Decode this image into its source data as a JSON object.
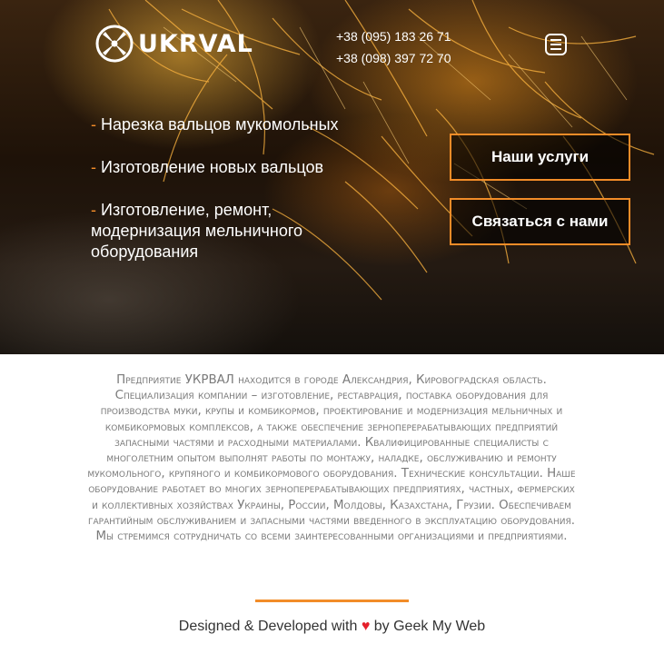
{
  "header": {
    "logo_text": "UKRVAL",
    "logo_icon": "ukrval-logo-mark-icon",
    "phones": [
      "+38 (095) 183 26 71",
      "+38 (098) 397 72 70"
    ],
    "menu_icon": "hamburger-menu-icon"
  },
  "hero": {
    "services": [
      {
        "bullet": "-",
        "text": "Нарезка вальцов мукомольных"
      },
      {
        "bullet": "-",
        "text": "Изготовление новых вальцов"
      },
      {
        "bullet": "-",
        "text": "Изготовление, ремонт, модернизация мельничного оборудования"
      }
    ],
    "buttons": {
      "services_label": "Наши услуги",
      "contact_label": "Связаться с нами"
    }
  },
  "about": {
    "text": "Предприятие УКРВАЛ находится в городе Александрия, Кировоградская область. Специализация компании – изготовление, реставрация, поставка оборудования для производства муки, крупы и комбикормов, проектирование и модернизация мельничных и комбикормовых комплексов, а также обеспечение зерноперерабатывающих предприятий запасными частями и расходными материалами. Квалифицированные специалисты с многолетним опытом выполнят работы по монтажу, наладке, обслуживанию и ремонту мукомольного, крупяного и комбикормового оборудования. Технические консультации. Наше оборудование работает во многих зерноперерабатывающих предприятиях, частных, фермерских и коллективных хозяйствах Украины, России, Молдовы, Казахстана, Грузии. Обеспечиваем гарантийным обслуживанием и запасными частями введенного в эксплуатацию оборудования. Мы стремимся сотрудничать со всеми заинтересованными организациями и предприятиями."
  },
  "footer": {
    "prefix": "Designed & Developed with",
    "heart": "♥",
    "suffix": "by Geek My Web"
  },
  "colors": {
    "accent": "#f28c28",
    "heart": "#e5202b",
    "about_text": "#7a7a7a"
  }
}
